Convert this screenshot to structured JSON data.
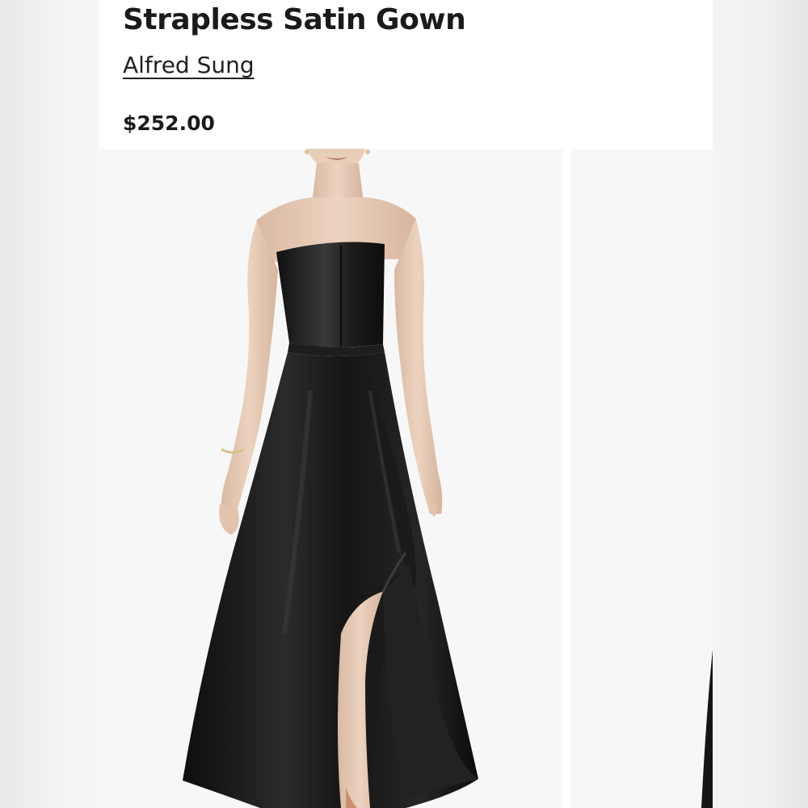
{
  "product": {
    "title": "Strapless Satin Gown",
    "brand": "Alfred Sung",
    "price": "$252.00"
  },
  "gallery": {
    "images": [
      {
        "subject": "woman wearing black strapless satin high-low gown, front view"
      },
      {
        "subject": "partial view of next gallery image"
      }
    ]
  },
  "colors": {
    "page_background": "#ffffff",
    "outer_background": "#efefef",
    "text": "#1a1a1a",
    "gown": "#141414"
  }
}
